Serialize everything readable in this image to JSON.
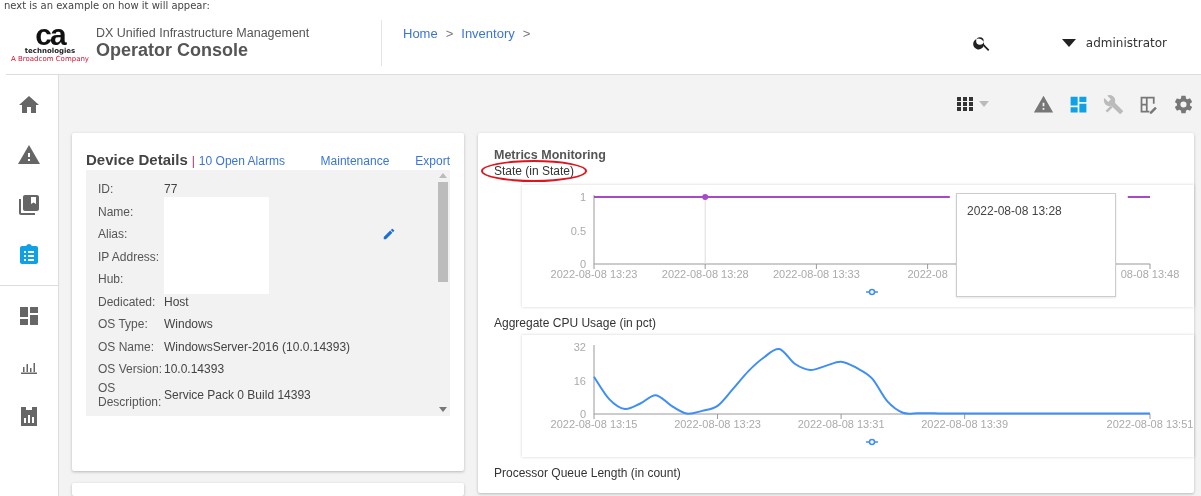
{
  "page_caption": "next is an example on how it will appear:",
  "header": {
    "logo": {
      "mark": "ca",
      "word": "technologies",
      "tagline": "A Broadcom Company"
    },
    "product": "DX Unified Infrastructure Management",
    "title": "Operator Console",
    "breadcrumb": [
      "Home",
      "Inventory"
    ],
    "breadcrumb_separator": ">",
    "user": "administrator"
  },
  "sidebar": {
    "items": [
      {
        "selected": false
      },
      {
        "selected": false
      },
      {
        "selected": false
      },
      {
        "selected": true
      },
      {
        "selected": false
      },
      {
        "selected": false
      },
      {
        "selected": false
      }
    ]
  },
  "toolbar": {
    "items": [
      {
        "selected": false,
        "disabled": false
      },
      {
        "selected": true,
        "disabled": false
      },
      {
        "selected": false,
        "disabled": true
      },
      {
        "selected": false,
        "disabled": false
      },
      {
        "selected": false,
        "disabled": false
      }
    ]
  },
  "device_details": {
    "title": "Device Details",
    "separator": "|",
    "alarms_link": "10 Open Alarms",
    "links": [
      "Maintenance",
      "Export"
    ],
    "fields": [
      {
        "label": "ID:",
        "value": "77"
      },
      {
        "label": "Name:",
        "redacted": true
      },
      {
        "label": "Alias:",
        "redacted": true,
        "editable": true
      },
      {
        "label": "IP Address:",
        "redacted": true
      },
      {
        "label": "Hub:",
        "redacted": true
      },
      {
        "label": "Dedicated:",
        "value": "Host"
      },
      {
        "label": "OS Type:",
        "value": "Windows"
      },
      {
        "label": "OS Name:",
        "value": "WindowsServer-2016 (10.0.14393)"
      },
      {
        "label": "OS Version:",
        "value": "10.0.14393"
      },
      {
        "label": "OS Description:",
        "value": "Service Pack 0 Build 14393"
      }
    ]
  },
  "metrics": {
    "title": "Metrics Monitoring",
    "charts": [
      {
        "title": "State (in State)",
        "circled": true,
        "tooltip": "2022-08-08 13:28",
        "chart_data": {
          "type": "line",
          "categories": [
            "2022-08-08 13:23",
            null,
            null,
            null,
            null,
            "2022-08-08 13:28",
            null,
            null,
            null,
            null,
            "2022-08-08 13:33",
            null,
            null,
            null,
            null,
            "2022-08",
            null,
            null,
            null,
            null,
            null,
            null,
            null,
            null,
            null,
            "08-08 13:48"
          ],
          "series": [
            {
              "color": "#a64ac9",
              "values": [
                1,
                1,
                1,
                1,
                1,
                1,
                1,
                1,
                1,
                1,
                1,
                1,
                1,
                1,
                1,
                1,
                1,
                null,
                null,
                null,
                null,
                null,
                null,
                null,
                1,
                1
              ]
            }
          ],
          "ylim": [
            0,
            1
          ],
          "yticks": [
            0,
            0.5,
            1
          ]
        }
      },
      {
        "title": "Aggregate CPU Usage (in pct)",
        "circled": false,
        "chart_data": {
          "type": "line",
          "categories": [
            "2022-08-08 13:15",
            null,
            null,
            null,
            null,
            null,
            null,
            null,
            "2022-08-08 13:23",
            null,
            null,
            null,
            null,
            null,
            null,
            null,
            "2022-08-08 13:31",
            null,
            null,
            null,
            null,
            null,
            null,
            null,
            "2022-08-08 13:39",
            null,
            null,
            null,
            null,
            null,
            null,
            null,
            null,
            null,
            null,
            null,
            "2022-08-08 13:51"
          ],
          "series": [
            {
              "color": "#3f8ef5",
              "values": [
                17.8,
                7,
                2.4,
                5,
                9,
                4,
                0.2,
                1.5,
                3.9,
                12,
                20.5,
                27,
                31,
                24,
                21,
                23,
                25,
                22,
                17,
                6,
                0.6,
                0.4,
                0.3,
                0.2,
                0.2,
                0.2,
                0.2,
                0.2,
                0.2,
                0.2,
                0.2,
                0.2,
                0.2,
                0.2,
                0.2,
                0.2,
                0.2
              ]
            }
          ],
          "ylim": [
            0,
            32
          ],
          "yticks": [
            0,
            16,
            32
          ]
        }
      },
      {
        "title": "Processor Queue Length (in count)",
        "circled": false
      }
    ]
  }
}
